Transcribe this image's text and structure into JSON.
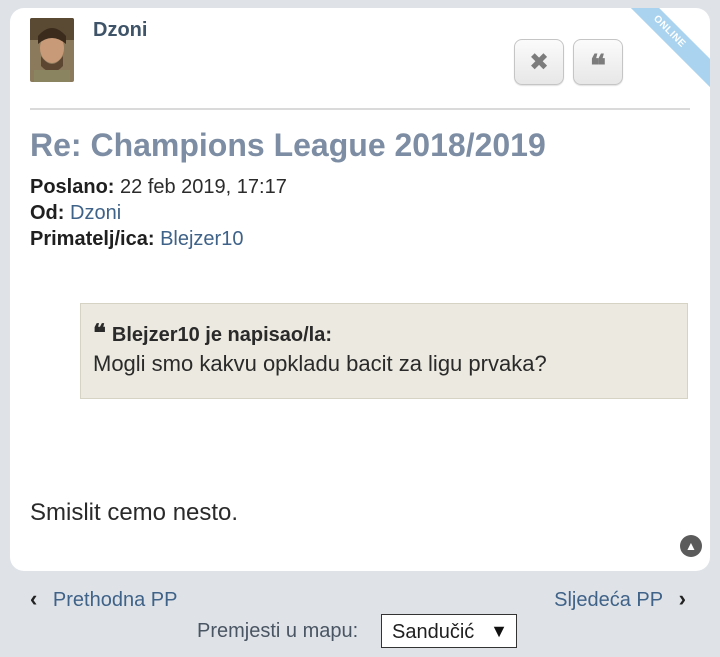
{
  "post": {
    "author": "Dzoni",
    "online_badge": "ONLINE",
    "title": "Re: Champions League 2018/2019",
    "sent_label": "Poslano:",
    "sent_value": "22 feb 2019, 17:17",
    "from_label": "Od:",
    "from_value": "Dzoni",
    "recipient_label": "Primatelj/ica:",
    "recipient_value": "Blejzer10",
    "quote": {
      "header": "Blejzer10 je napisao/la:",
      "text": "Mogli smo kakvu opkladu bacit za ligu prvaka?"
    },
    "body": "Smislit cemo nesto."
  },
  "actions": {
    "delete_icon": "close-icon",
    "quote_icon": "quote-icon"
  },
  "nav": {
    "prev": "Prethodna PP",
    "next": "Sljedeća PP",
    "move_label": "Premjesti u mapu:",
    "folder_selected": "Sandučić"
  },
  "colors": {
    "title": "#7d8da3",
    "link": "#3f6288",
    "quote_bg": "#ebe9e0",
    "online_ribbon": "#a9d3ef",
    "page_bg": "#dfe3e8"
  }
}
